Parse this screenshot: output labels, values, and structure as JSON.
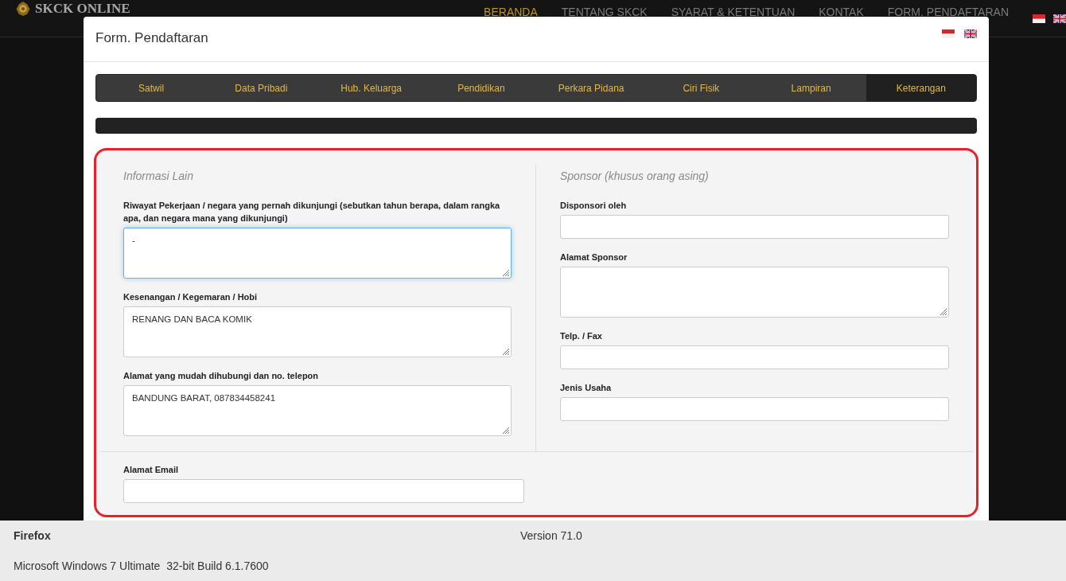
{
  "nav": {
    "brand": "SKCK ONLINE",
    "items": [
      {
        "label": "BERANDA",
        "selected": true
      },
      {
        "label": "TENTANG SKCK",
        "selected": false
      },
      {
        "label": "SYARAT & KETENTUAN",
        "selected": false
      },
      {
        "label": "KONTAK",
        "selected": false
      },
      {
        "label": "FORM. PENDAFTARAN",
        "selected": false
      }
    ]
  },
  "modal": {
    "title": "Form. Pendaftaran",
    "progress": {
      "level": 1
    },
    "tabs": [
      {
        "label": "Satwil",
        "selected": false
      },
      {
        "label": "Data Pribadi",
        "selected": false
      },
      {
        "label": "Hub. Keluarga",
        "selected": false
      },
      {
        "label": "Pendidikan",
        "selected": false
      },
      {
        "label": "Perkara Pidana",
        "selected": false
      },
      {
        "label": "Ciri Fisik",
        "selected": false
      },
      {
        "label": "Lampiran",
        "selected": false
      },
      {
        "label": "Keterangan",
        "selected": true
      }
    ],
    "left": {
      "heading": "Informasi Lain",
      "fields": [
        {
          "kind": "textarea",
          "label": "Riwayat Pekerjaan / negara yang pernah dikunjungi (sebutkan tahun berapa, dalam rangka apa, dan negara mana yang dikunjungi)",
          "value": "-",
          "focused": true
        },
        {
          "kind": "textarea",
          "label": "Kesenangan / Kegemaran / Hobi",
          "value": "RENANG DAN BACA KOMIK",
          "focused": false
        },
        {
          "kind": "textarea",
          "label": "Alamat yang mudah dihubungi dan no. telepon",
          "value": "BANDUNG BARAT, 087834458241",
          "focused": false
        }
      ]
    },
    "right": {
      "heading": "Sponsor (khusus orang asing)",
      "fields": [
        {
          "kind": "input",
          "label": "Disponsori oleh",
          "focused": false
        },
        {
          "kind": "textarea",
          "label": "Alamat Sponsor",
          "focused": false
        },
        {
          "kind": "input",
          "label": "Telp. / Fax",
          "focused": false
        },
        {
          "kind": "input",
          "label": "Jenis Usaha",
          "focused": false
        }
      ]
    },
    "bottom_fields": [
      {
        "kind": "input",
        "label": "Alamat Email",
        "focused": false
      }
    ]
  },
  "footer": {
    "browser": "Firefox",
    "version": "Version 71.0",
    "os": "Microsoft Windows 7 Ultimate  32-bit Build 6.1.7600"
  }
}
